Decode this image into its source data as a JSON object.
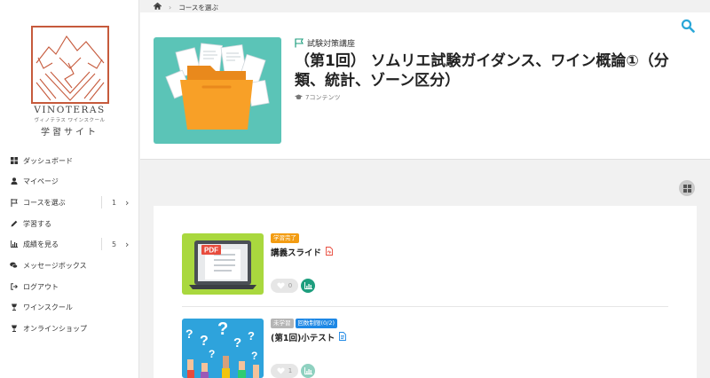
{
  "brand": {
    "name": "VINOTERAS",
    "kana": "ヴィノテラス ワインスクール",
    "site": "学習サイト"
  },
  "sidebar": {
    "items": [
      {
        "label": "ダッシュボード",
        "icon": "dashboard-icon"
      },
      {
        "label": "マイページ",
        "icon": "user-icon"
      },
      {
        "label": "コースを選ぶ",
        "icon": "flag-icon",
        "count": "1"
      },
      {
        "label": "学習する",
        "icon": "pencil-icon"
      },
      {
        "label": "成績を見る",
        "icon": "bar-chart-icon",
        "count": "5"
      },
      {
        "label": "メッセージボックス",
        "icon": "comments-icon"
      },
      {
        "label": "ログアウト",
        "icon": "sign-out-icon"
      },
      {
        "label": "ワインスクール",
        "icon": "wine-glass-icon"
      },
      {
        "label": "オンラインショップ",
        "icon": "wine-glass-icon"
      }
    ]
  },
  "breadcrumb": {
    "current": "コースを選ぶ"
  },
  "course": {
    "category": "試験対策講座",
    "title": "（第1回） ソムリエ試験ガイダンス、ワイン概論①（分類、統計、ゾーン区分）",
    "contents_count": "7コンテンツ"
  },
  "items": [
    {
      "badges": [
        {
          "text": "学習完了",
          "color": "#f39c12"
        }
      ],
      "title": "講義スライド",
      "thumb_label": "PDF",
      "likes": "0"
    },
    {
      "badges": [
        {
          "text": "未学習",
          "color": "#b5b5b5"
        },
        {
          "text": "回数制限(0/2)",
          "color": "#1e88e5"
        }
      ],
      "title": "(第1回)小テスト",
      "likes": "1"
    }
  ],
  "colors": {
    "accent": "#1e9e7e",
    "search": "#2aa7d8",
    "thumb_bg": "#5bc4b7",
    "logo": "#c65a3c"
  }
}
